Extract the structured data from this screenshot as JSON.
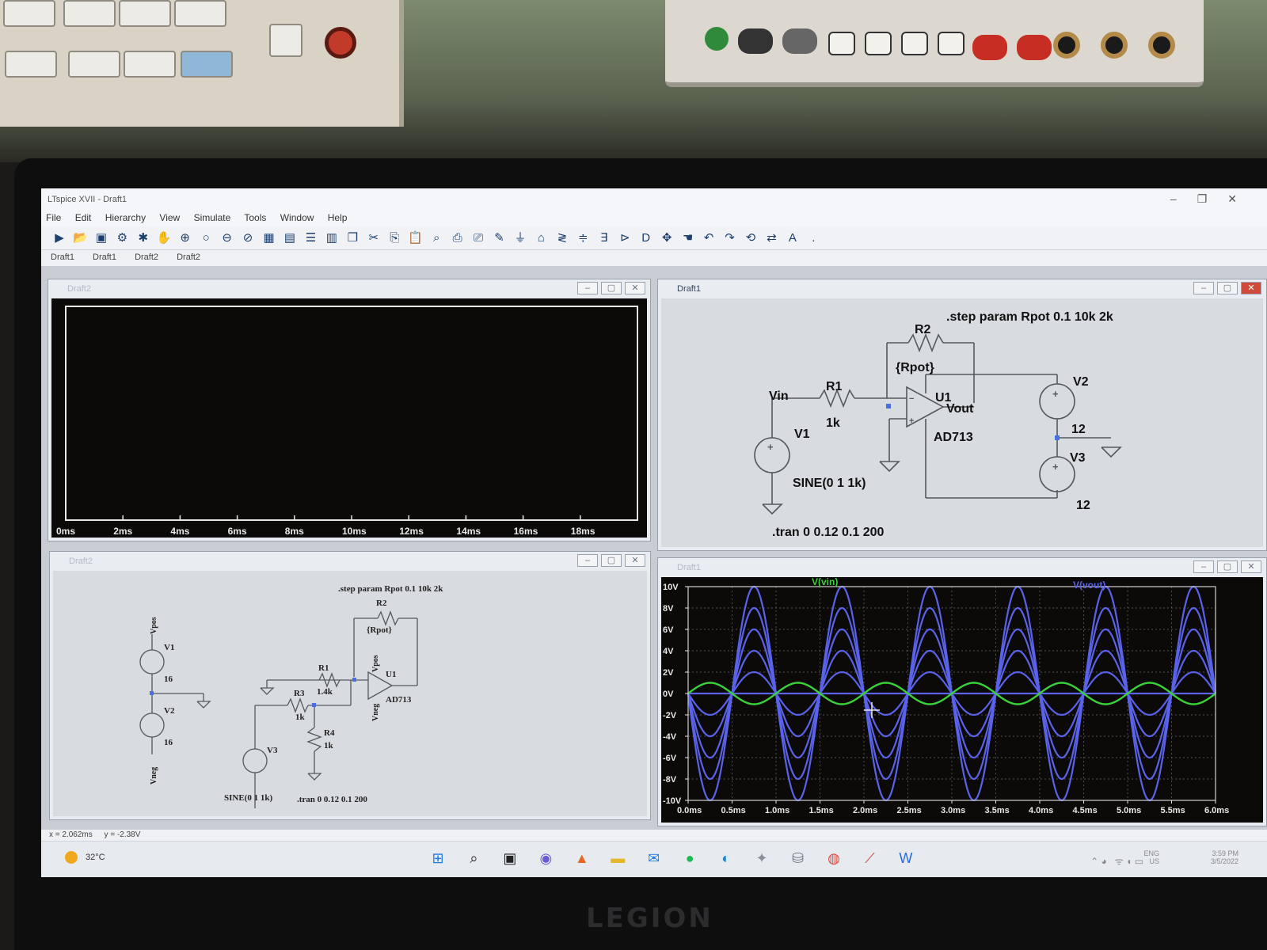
{
  "window": {
    "title": "LTspice XVII - Draft1",
    "controls": [
      "–",
      "❐",
      "✕"
    ]
  },
  "menu": [
    "File",
    "Edit",
    "Hierarchy",
    "View",
    "Simulate",
    "Tools",
    "Window",
    "Help"
  ],
  "tabs": [
    "Draft1",
    "Draft1",
    "Draft2",
    "Draft2"
  ],
  "windows": {
    "plot_empty": {
      "title": "Draft2",
      "x_ticks": [
        "0ms",
        "2ms",
        "4ms",
        "6ms",
        "8ms",
        "10ms",
        "12ms",
        "14ms",
        "16ms",
        "18ms"
      ]
    },
    "schematic1": {
      "title": "Draft1",
      "step_directive": ".step param Rpot 0.1 10k 2k",
      "tran_directive": ".tran 0 0.12 0.1 200",
      "source_spec": "SINE(0 1 1k)",
      "labels": {
        "r2": "R2",
        "rpot": "{Rpot}",
        "r1": "R1",
        "r1_val": "1k",
        "vin": "Vin",
        "v1": "V1",
        "u1": "U1",
        "vout": "Vout",
        "ad713": "AD713",
        "v2": "V2",
        "v2_val": "12",
        "v3": "V3",
        "v3_val": "12"
      }
    },
    "schematic2": {
      "title": "Draft2",
      "step_directive": ".step param Rpot 0.1 10k 2k",
      "tran_directive": ".tran 0 0.12 0.1 200",
      "source_spec": "SINE(0 1 1k)",
      "labels": {
        "vpos_top": "Vpos",
        "v1": "V1",
        "v1_val": "16",
        "v2": "V2",
        "v2_val": "16",
        "vneg_bot": "Vneg",
        "r2": "R2",
        "rpot": "{Rpot}",
        "r1": "R1",
        "r1_val": "1.4k",
        "r3": "R3",
        "r3_val": "1k",
        "r4": "R4",
        "r4_val": "1k",
        "u1": "U1",
        "ad713": "AD713",
        "vpos_op": "Vpos",
        "vneg_op": "Vneg",
        "v3": "V3"
      }
    },
    "plot_wave": {
      "title": "Draft1",
      "trace_vin": "V(vin)",
      "trace_vout": "V(vout)",
      "color_vin": "#3bd13b",
      "color_vout": "#5a62ea"
    }
  },
  "status": {
    "x": "x = 2.062ms",
    "y": "y = -2.38V"
  },
  "taskbar": {
    "weather": "32°C",
    "time": "3:59 PM",
    "date": "3/5/2022",
    "lang": "ENG\nUS"
  },
  "chart_data": {
    "type": "line",
    "xlabel": "",
    "ylabel": "",
    "x_ticks": [
      "0.0ms",
      "0.5ms",
      "1.0ms",
      "1.5ms",
      "2.0ms",
      "2.5ms",
      "3.0ms",
      "3.5ms",
      "4.0ms",
      "4.5ms",
      "5.0ms",
      "5.5ms",
      "6.0ms"
    ],
    "y_ticks": [
      "10V",
      "8V",
      "6V",
      "4V",
      "2V",
      "0V",
      "-2V",
      "-4V",
      "-6V",
      "-8V",
      "-10V"
    ],
    "xlim": [
      0,
      6
    ],
    "ylim": [
      -10,
      10
    ],
    "grid": true,
    "frequency_hz": 1000,
    "series": [
      {
        "name": "V(vin)",
        "amplitude_v": 1,
        "color": "#3bd13b"
      },
      {
        "name": "V(vout)",
        "amplitude_v": 0.0001,
        "color": "#5a62ea"
      },
      {
        "name": "V(vout)",
        "amplitude_v": 2,
        "color": "#5a62ea"
      },
      {
        "name": "V(vout)",
        "amplitude_v": 4,
        "color": "#5a62ea"
      },
      {
        "name": "V(vout)",
        "amplitude_v": 6,
        "color": "#5a62ea"
      },
      {
        "name": "V(vout)",
        "amplitude_v": 8,
        "color": "#5a62ea"
      },
      {
        "name": "V(vout)",
        "amplitude_v": 10,
        "color": "#5a62ea"
      }
    ]
  }
}
